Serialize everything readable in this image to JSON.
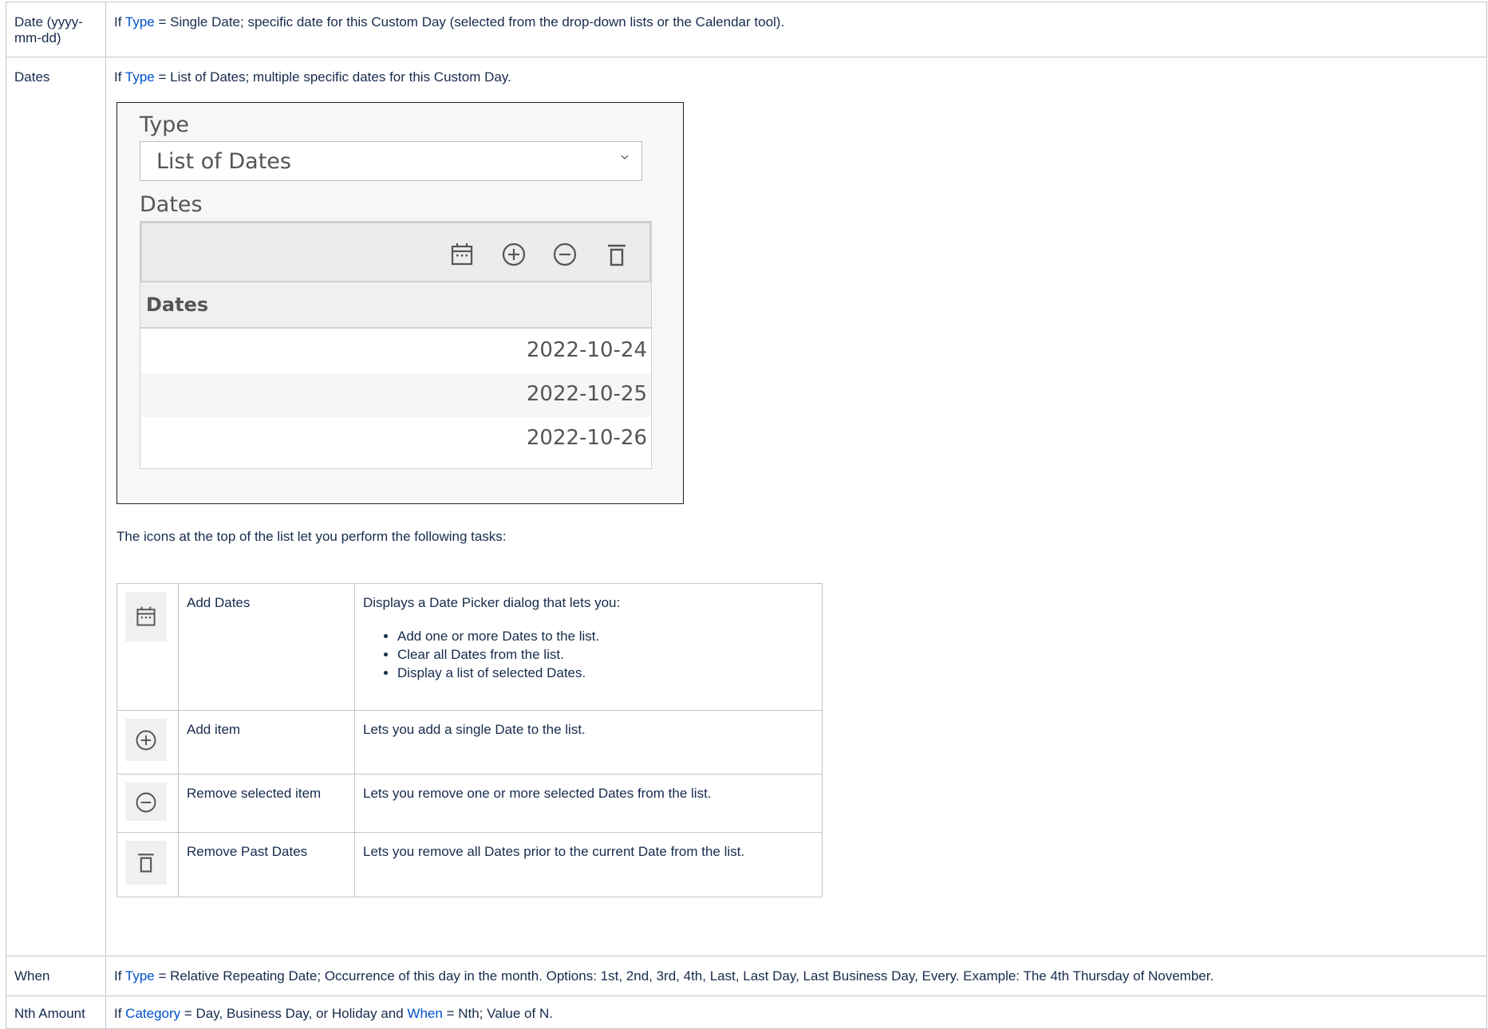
{
  "rows": {
    "date": {
      "label": "Date (yyyy-mm-dd)",
      "prefix": "If ",
      "link": "Type",
      "text": " = Single Date; specific date for this Custom Day (selected from the drop-down lists or the Calendar tool)."
    },
    "dates": {
      "label": "Dates",
      "prefix": "If ",
      "link": "Type",
      "text": " = List of Dates; multiple specific dates for this Custom Day.",
      "icons_intro": "The icons at the top of the list let you perform the following tasks:"
    },
    "when": {
      "label": "When",
      "prefix": "If ",
      "link": "Type",
      "text": " = Relative Repeating Date; Occurrence of this day in the month. Options: 1st, 2nd, 3rd, 4th, Last, Last Day, Last Business Day, Every. Example: The 4th Thursday of November."
    },
    "nth": {
      "label": "Nth Amount",
      "prefix": "If ",
      "link1": "Category",
      "mid": " = Day, Business Day, or Holiday and ",
      "link2": "When",
      "text": " = Nth; Value of N."
    }
  },
  "panel": {
    "type_label": "Type",
    "type_value": "List of Dates",
    "dates_label": "Dates",
    "column_header": "Dates",
    "dates": [
      "2022-10-24",
      "2022-10-25",
      "2022-10-26"
    ],
    "toolbar_icons": [
      "calendar-icon",
      "plus-circle-icon",
      "minus-circle-icon",
      "trash-icon"
    ]
  },
  "icon_table": [
    {
      "icon": "calendar-icon",
      "name": "Add Dates",
      "description": "Displays a Date Picker dialog that lets you:",
      "options": [
        "Add one or more Dates to the list.",
        "Clear all Dates from the list.",
        "Display a list of selected Dates."
      ]
    },
    {
      "icon": "plus-circle-icon",
      "name": "Add item",
      "description": "Lets you add a single Date to the list."
    },
    {
      "icon": "minus-circle-icon",
      "name": "Remove selected item",
      "description": "Lets you remove one or more selected Dates from the list."
    },
    {
      "icon": "trash-icon",
      "name": "Remove Past Dates",
      "description": "Lets you remove all Dates prior to the current Date from the list."
    }
  ],
  "colors": {
    "link": "#0052cc",
    "border": "#c1c7d0",
    "text": "#172b4d"
  }
}
